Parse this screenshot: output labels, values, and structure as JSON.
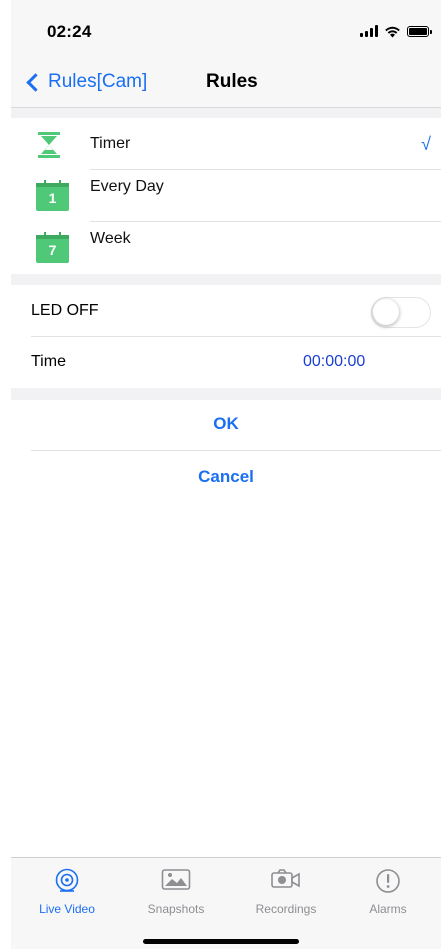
{
  "status_bar": {
    "time": "02:24"
  },
  "nav": {
    "back_label": "Rules[Cam]",
    "title": "Rules"
  },
  "rules": [
    {
      "label": "Timer",
      "icon": "hourglass-icon",
      "checked": true,
      "check_mark": "√"
    },
    {
      "label": "Every Day",
      "icon": "calendar-1-icon",
      "number": "1"
    },
    {
      "label": "Week",
      "icon": "calendar-7-icon",
      "number": "7"
    }
  ],
  "led": {
    "label": "LED OFF",
    "enabled": false
  },
  "time_setting": {
    "label": "Time",
    "value": "00:00:00"
  },
  "actions": {
    "ok": "OK",
    "cancel": "Cancel"
  },
  "tabs": [
    {
      "label": "Live Video",
      "icon": "live-video-icon",
      "active": true
    },
    {
      "label": "Snapshots",
      "icon": "snapshots-icon",
      "active": false
    },
    {
      "label": "Recordings",
      "icon": "recordings-icon",
      "active": false
    },
    {
      "label": "Alarms",
      "icon": "alarms-icon",
      "active": false
    }
  ],
  "colors": {
    "accent": "#1a6ff2",
    "calendar_green": "#4fc878",
    "time_value": "#1a3fd1"
  }
}
